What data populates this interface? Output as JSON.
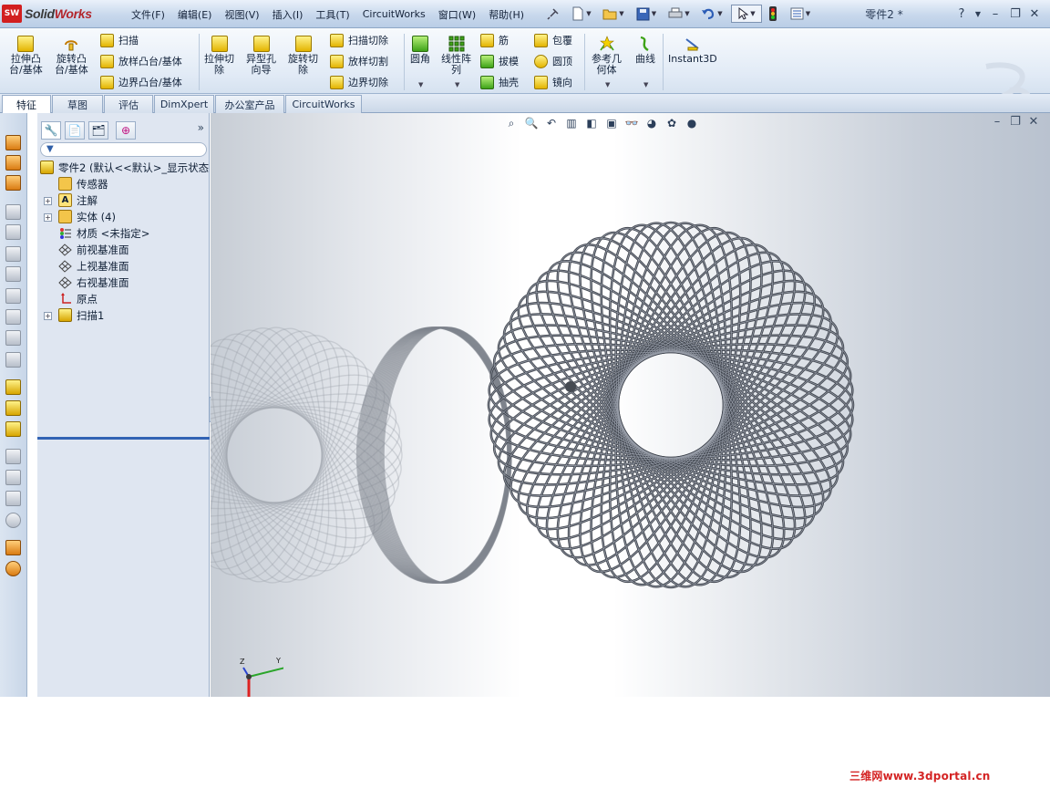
{
  "app": {
    "brand_prefix": "Solid",
    "brand_suffix": "Works",
    "logo_badge": "SW"
  },
  "menu": [
    "文件(F)",
    "编辑(E)",
    "视图(V)",
    "插入(I)",
    "工具(T)",
    "CircuitWorks",
    "窗口(W)",
    "帮助(H)"
  ],
  "document_title": "零件2 *",
  "help_label": "?",
  "features": {
    "extrude_boss": "拉伸凸\n台/基体",
    "revolve_boss": "旋转凸\n台/基体",
    "sweep": "扫描",
    "loft_boss": "放样凸台/基体",
    "boundary_boss": "边界凸台/基体",
    "extrude_cut": "拉伸切\n除",
    "hole_wizard": "异型孔\n向导",
    "revolve_cut": "旋转切\n除",
    "swept_cut": "扫描切除",
    "lofted_cut": "放样切割",
    "boundary_cut": "边界切除",
    "fillet": "圆角",
    "linear_pattern": "线性阵\n列",
    "rib": "筋",
    "draft": "拔模",
    "shell": "抽壳",
    "wrap": "包覆",
    "dome": "圆顶",
    "mirror": "镜向",
    "ref_geometry": "参考几\n何体",
    "curves": "曲线",
    "instant3d": "Instant3D"
  },
  "tabs": [
    {
      "label": "特征",
      "active": true
    },
    {
      "label": "草图",
      "active": false
    },
    {
      "label": "评估",
      "active": false
    },
    {
      "label": "DimXpert",
      "active": false
    },
    {
      "label": "办公室产品",
      "active": false
    },
    {
      "label": "CircuitWorks",
      "active": false
    }
  ],
  "feature_tree": [
    {
      "label": "零件2  (默认<<默认>_显示状态",
      "icon": "part-icon",
      "expandable": false
    },
    {
      "label": "传感器",
      "icon": "sensor-folder-icon",
      "expandable": false
    },
    {
      "label": "注解",
      "icon": "annotations-icon",
      "expandable": true
    },
    {
      "label": "实体 (4)",
      "icon": "solid-bodies-icon",
      "expandable": true
    },
    {
      "label": "材质 <未指定>",
      "icon": "material-icon",
      "expandable": false
    },
    {
      "label": "前视基准面",
      "icon": "plane-icon",
      "expandable": false
    },
    {
      "label": "上视基准面",
      "icon": "plane-icon",
      "expandable": false
    },
    {
      "label": "右视基准面",
      "icon": "plane-icon",
      "expandable": false
    },
    {
      "label": "原点",
      "icon": "origin-icon",
      "expandable": false
    },
    {
      "label": "扫描1",
      "icon": "sweep-feature-icon",
      "expandable": true
    }
  ],
  "triad": {
    "y": "Y",
    "z": "Z"
  },
  "watermark": "三维网www.3dportal.cn",
  "colors": {
    "accent": "#3263b4",
    "wire": "#3b404a",
    "brand_red": "#d21f1f"
  }
}
